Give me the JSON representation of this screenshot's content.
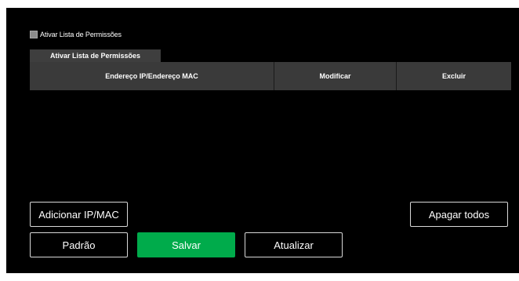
{
  "allowlist": {
    "checkbox_label": "Ativar Lista de Permissões",
    "checked": false,
    "tab_label": "Ativar Lista de Permissões"
  },
  "table": {
    "columns": [
      "Endereço IP/Endereço MAC",
      "Modificar",
      "Excluir"
    ],
    "rows": []
  },
  "buttons": {
    "add": "Adicionar IP/MAC",
    "delete_all": "Apagar todos",
    "default": "Padrão",
    "save": "Salvar",
    "refresh": "Atualizar"
  },
  "colors": {
    "background": "#000000",
    "header": "#3a3a3a",
    "primary": "#00ab4b"
  }
}
